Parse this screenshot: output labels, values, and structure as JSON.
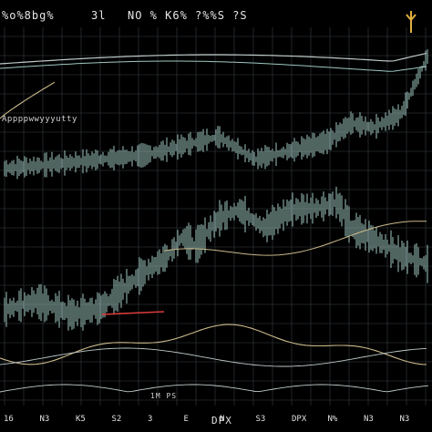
{
  "header": {
    "left": "%o%8bg%",
    "mid": "3l",
    "right": "NO  %  K6%  ?%%S  ?S"
  },
  "subtitle": "Appppwwyyyutty",
  "labels": {
    "dpx": "DPX",
    "box": "1M  PS"
  },
  "x_ticks": [
    "16",
    "N3",
    "K5",
    "S2",
    "3",
    "E",
    "N",
    "S3",
    "DPX",
    "N%",
    "N3",
    "N3"
  ],
  "colors": {
    "background": "#000000",
    "grid": "#3a3f44",
    "price": "#9fc7c1",
    "upper": "#bfc9c9",
    "lower": "#c9b98a",
    "marker": "#d83a3a"
  },
  "chart_data": {
    "type": "line",
    "grid": true,
    "x_count": 470,
    "series": [
      {
        "name": "",
        "role": "price"
      },
      {
        "name": "",
        "role": "envelope-upper"
      },
      {
        "name": "",
        "role": "envelope-lower"
      },
      {
        "name": "",
        "role": "oscillator"
      }
    ]
  }
}
